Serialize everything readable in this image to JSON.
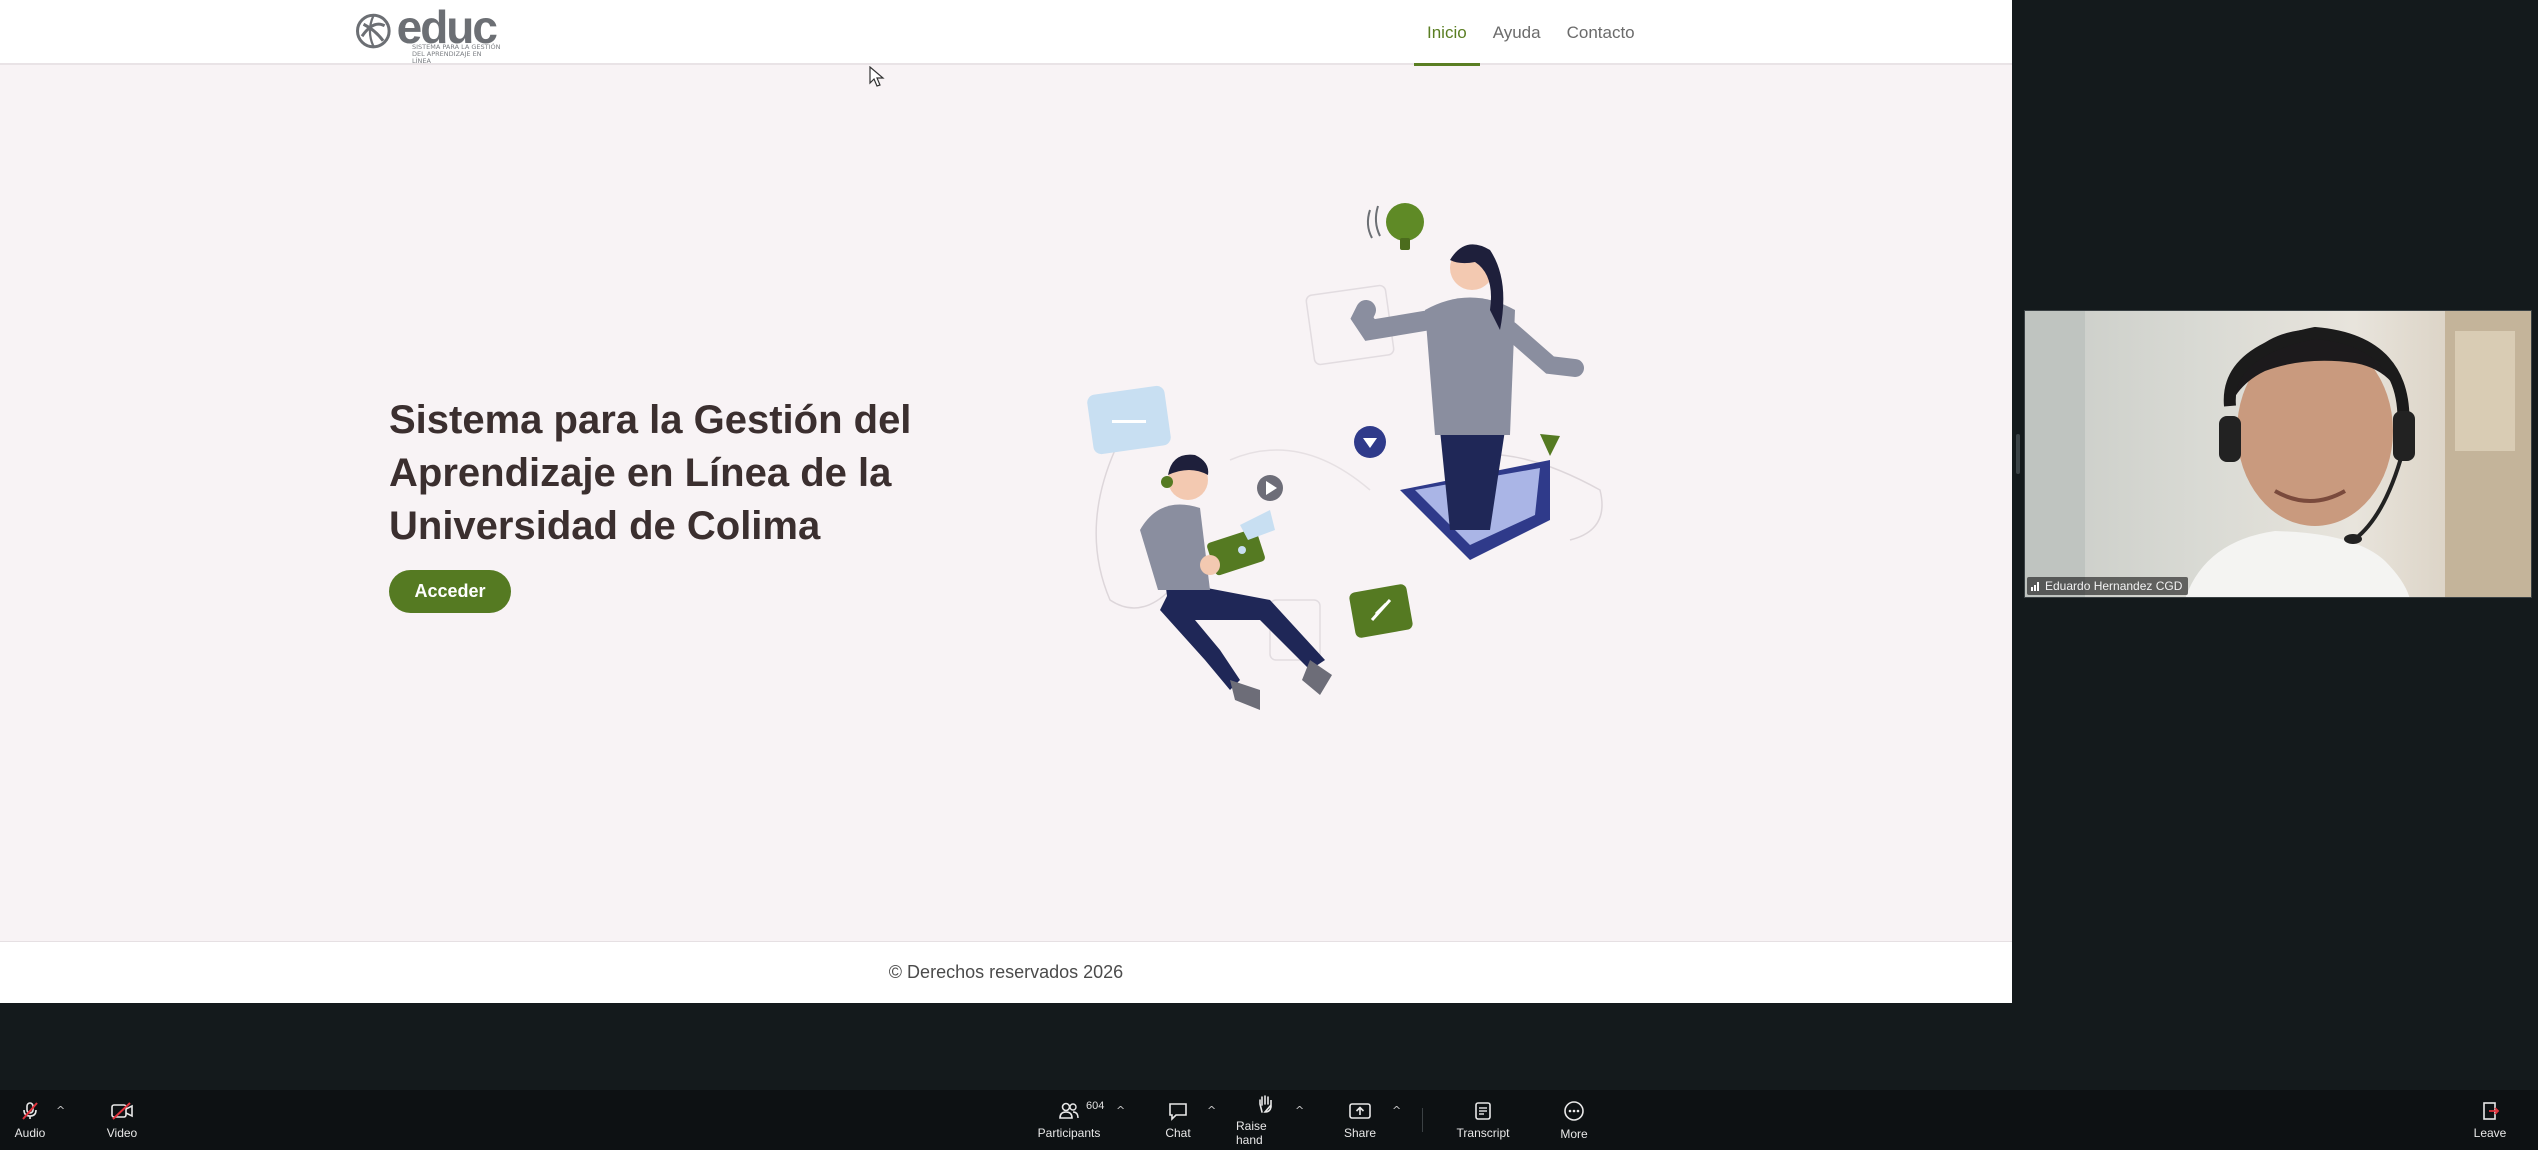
{
  "site": {
    "logo_text": "educ",
    "logo_tagline": "SISTEMA PARA LA GESTIÓN DEL APRENDIZAJE EN LÍNEA",
    "nav": [
      {
        "label": "Inicio",
        "active": true
      },
      {
        "label": "Ayuda",
        "active": false
      },
      {
        "label": "Contacto",
        "active": false
      }
    ],
    "hero_title": "Sistema para la Gestión del Aprendizaje en Línea de la Universidad de Colima",
    "cta_label": "Acceder",
    "footer_text": "© Derechos reservados 2026"
  },
  "meeting": {
    "participant_name": "Eduardo Hernandez CGD",
    "toolbar": {
      "audio": "Audio",
      "video": "Video",
      "participants": "Participants",
      "participants_count": "604",
      "chat": "Chat",
      "raise_hand": "Raise hand",
      "share": "Share",
      "transcript": "Transcript",
      "more": "More",
      "leave": "Leave"
    }
  },
  "colors": {
    "brand_green": "#557a22",
    "page_bg": "#f8f3f5",
    "title_text": "#3b2f2f",
    "toolbar_bg": "#0d1113",
    "muted_red": "#e0323c"
  }
}
